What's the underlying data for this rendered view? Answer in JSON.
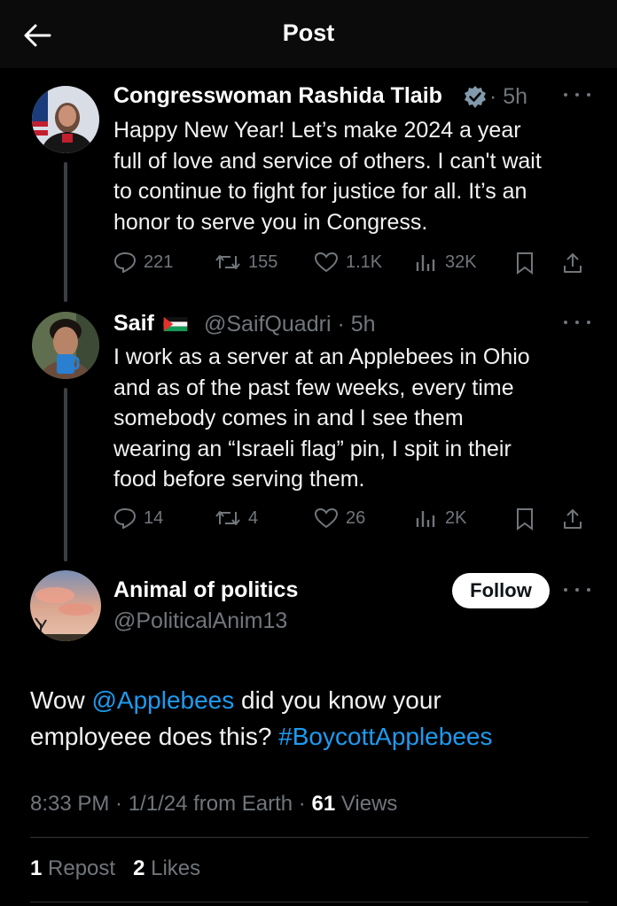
{
  "header": {
    "title": "Post"
  },
  "thread": [
    {
      "name": "Congresswoman Rashida Tlaib",
      "verified": true,
      "meta": "· 5h",
      "lines": [
        "Happy New Year! Let’s make 2024 a year",
        "full of love and service of others. I can't wait",
        "to continue to fight for justice for all. It’s an",
        "honor to serve you in Congress."
      ],
      "stats": {
        "replies": "221",
        "reposts": "155",
        "likes": "1.1K",
        "views": "32K"
      }
    },
    {
      "name": "Saif",
      "handle_meta": "@SaifQuadri · 5h",
      "flag": "palestine-flag",
      "lines": [
        "I work as a server at an Applebees in Ohio",
        "and as of the past few weeks, every time",
        "somebody comes in and I see them",
        "wearing an “Israeli flag” pin, I spit in their",
        "food before serving them."
      ],
      "stats": {
        "replies": "14",
        "reposts": "4",
        "likes": "26",
        "views": "2K"
      }
    }
  ],
  "main_post": {
    "name": "Animal of politics",
    "handle": "@PoliticalAnim13",
    "follow_label": "Follow",
    "text": {
      "t1": "Wow ",
      "mention": "@Applebees",
      "t2": " did you know your",
      "t3": "employeee does this? ",
      "hashtag": "#BoycottApplebees"
    },
    "timestamp": "8:33 PM · 1/1/24 from Earth · ",
    "views_count": "61",
    "views_label": " Views",
    "reposts_count": "1",
    "reposts_label": " Repost",
    "likes_count": "2",
    "likes_label": " Likes"
  },
  "colors": {
    "link": "#1d9bf0",
    "muted": "#71767b",
    "background": "#000000"
  },
  "icons": [
    "back-arrow-icon",
    "verified-badge-icon",
    "more-icon",
    "reply-icon",
    "repost-icon",
    "like-icon",
    "views-icon",
    "bookmark-icon",
    "share-icon"
  ]
}
